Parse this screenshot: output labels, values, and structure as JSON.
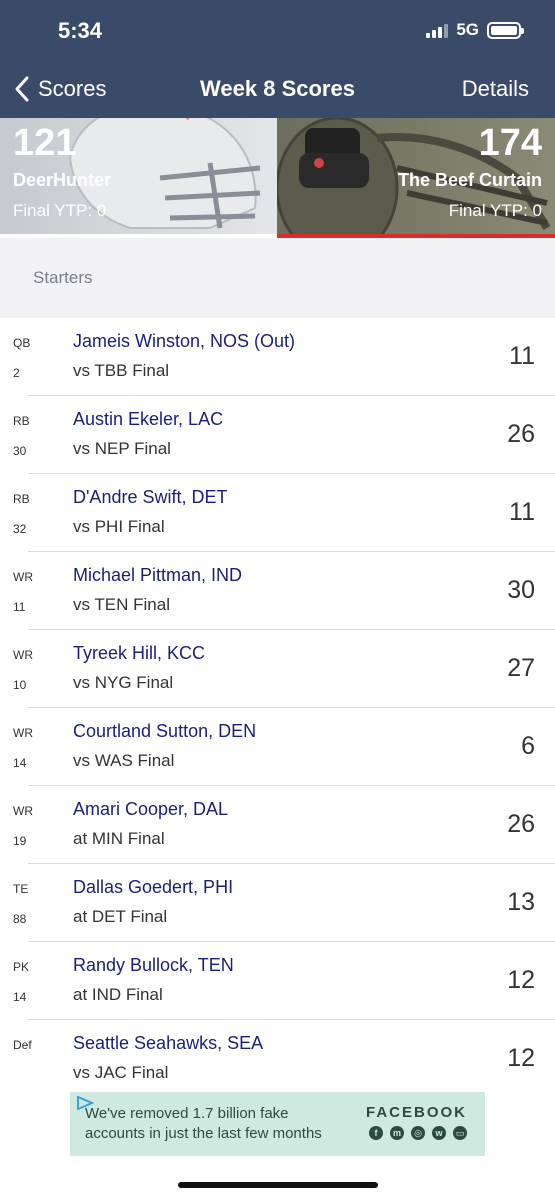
{
  "status_bar": {
    "time": "5:34",
    "network": "5G"
  },
  "nav": {
    "back_label": "Scores",
    "title": "Week 8 Scores",
    "details_label": "Details"
  },
  "teams": [
    {
      "score": "121",
      "name": "DeerHunter",
      "ytp": "Final YTP: 0"
    },
    {
      "score": "174",
      "name": "The Beef Curtain",
      "ytp": "Final YTP: 0"
    }
  ],
  "section_title": "Starters",
  "players": [
    {
      "pos": "QB",
      "num": "2",
      "name": "Jameis Winston, NOS (Out)",
      "opp": "vs TBB  Final",
      "pts": "11"
    },
    {
      "pos": "RB",
      "num": "30",
      "name": "Austin Ekeler, LAC",
      "opp": "vs NEP  Final",
      "pts": "26"
    },
    {
      "pos": "RB",
      "num": "32",
      "name": "D'Andre Swift, DET",
      "opp": "vs PHI  Final",
      "pts": "11"
    },
    {
      "pos": "WR",
      "num": "11",
      "name": "Michael Pittman, IND",
      "opp": "vs TEN  Final",
      "pts": "30"
    },
    {
      "pos": "WR",
      "num": "10",
      "name": "Tyreek Hill, KCC",
      "opp": "vs NYG  Final",
      "pts": "27"
    },
    {
      "pos": "WR",
      "num": "14",
      "name": "Courtland Sutton, DEN",
      "opp": "vs WAS  Final",
      "pts": "6"
    },
    {
      "pos": "WR",
      "num": "19",
      "name": "Amari Cooper, DAL",
      "opp": "at MIN  Final",
      "pts": "26"
    },
    {
      "pos": "TE",
      "num": "88",
      "name": "Dallas Goedert, PHI",
      "opp": "at DET  Final",
      "pts": "13"
    },
    {
      "pos": "PK",
      "num": "14",
      "name": "Randy Bullock, TEN",
      "opp": "at IND  Final",
      "pts": "12"
    },
    {
      "pos": "Def",
      "num": "",
      "name": "Seattle Seahawks, SEA",
      "opp": "vs JAC  Final",
      "pts": "12"
    }
  ],
  "ad": {
    "line1": "We've removed 1.7 billion fake",
    "line2": "accounts in just the last few months",
    "brand": "FACEBOOK"
  },
  "colors": {
    "header_bg": "#3a4a69",
    "player_link": "#1a1f77",
    "winner_bar": "#d42d2d",
    "ad_bg": "#cfe9e0"
  }
}
